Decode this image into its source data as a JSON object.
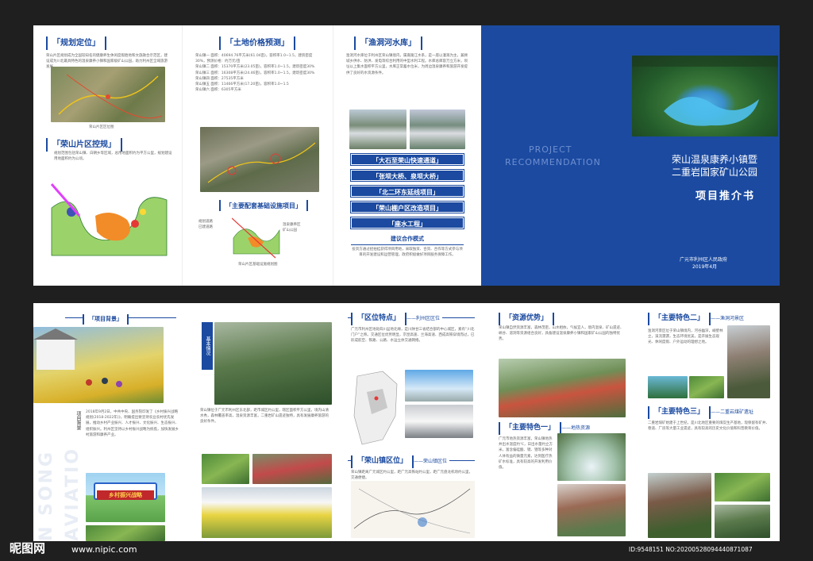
{
  "top": {
    "p1": {
      "title1": "「规划定位」",
      "text1": "荣山片区规划成为全国较知名的健康养生休闲度假胜地和文旅融合示范区，建设成为川北最具特色的温泉康养小镇和国家级矿山公园，助力利州区全域旅游发展。",
      "map_caption": "荣山片区区位图",
      "title2": "「荣山片区控规」",
      "text2": "规划范围包括荣山镇、白朝乡等区域，总用地面积约为平方公里，规划建设用地面积约为公顷。"
    },
    "p2": {
      "title1": "「土地价格预测」",
      "lines": [
        "荣山镇一 面积：40694.76平方米(61.04亩)，容积率1.0~1.5，建筑密度30%，预测价格：约万元/亩",
        "荣山镇二 面积：15370平方米(23.05亩)，容积率1.0~1.5，建筑密度30%",
        "荣山镇三 面积：16308平方米(24.46亩)，容积率1.0~1.5，建筑密度30%",
        "荣山镇四 面积：27535平方米",
        "荣山镇五 面积：11466平方米(17.20亩)，容积率1.0~1.5",
        "荣山镇六 面积：6305平方米"
      ],
      "title2": "「主要配套基础设施项目」",
      "legend": [
        "规划道路",
        "已建道路",
        "温泉康养区",
        "矿山公园"
      ],
      "plan_caption": "荣山片区基础设施规划图"
    },
    "p3": {
      "title": "「渔洞河水库」",
      "text": "渔洞河水库位于利州区荣山镇境内，属嘉陵江水系，是一座以灌溉为主，兼顾城乡供水、防洪、发电等综合利用的中型水利工程。水库总库容万立方米，坝址以上集水面积平方公里，水库正常蓄水位米，为周边温泉康养和旅游开发提供了良好的水资源条件。",
      "buttons": [
        "「大石至荣山快速通道」",
        "「张坝大桥、泉坝大桥」",
        "「北二环东延线项目」",
        "「荣山棚户区改造项目」",
        "「座水工程」"
      ],
      "coop_title": "建议合作模式",
      "coop_text": "投资方通过招拍挂获得项目用地，采取独资、合资、合作等方式参与项目的开发建设和运营管理，政府积极做好项目服务保障工作。"
    },
    "cover": {
      "en1": "PROJECT",
      "en2": "RECOMMENDATION",
      "title1": "荣山温泉康养小镇暨",
      "title2": "二重岩国家矿山公园",
      "subtitle": "项目推介书",
      "issuer": "广元市利州区人民政府",
      "date": "2019年4月"
    }
  },
  "bottom": {
    "p1": {
      "title": "「项目背景」",
      "vertical_label": "项目背景",
      "text": "2018年9月2日，中共中央、国务院印发了《乡村振兴战略规划(2018-2022年)》，明确提出要坚持农业农村优先发展，推动乡村产业振兴、人才振兴、文化振兴、生态振兴、组织振兴。利州区坚持以乡村振兴战略为统揽，加快发展乡村旅游和康养产业。",
      "banner": "乡村振兴战略",
      "watermark": "N SONG AVIATIO"
    },
    "p2": {
      "vertical_label": "基本情况",
      "text": "荣山镇位于广元市利州区东北部，距市城区约公里，辖区面积平方公里，境内山清水秀，森林覆盖率高，温泉资源丰富，二重岩矿山遗迹独特，具有发展康养旅游的良好条件。"
    },
    "p3": {
      "title1": "「区位特点」",
      "tail1": "——利州区区位",
      "text1": "广元市利州区地处四川盆地北缘，是川陕甘三省结合部的中心城区，素有“川北门户”之称。交通区位优势明显，京昆高速、兰海高速、西成高铁穿境而过，已形成航空、铁路、公路、水运立体交通网络。",
      "title2": "「荣山镇区位」",
      "tail2": "——荣山镇区位",
      "text2": "荣山镇距离广元城区约公里，距广元高铁站约公里，距广元盘龙机场约公里，交通便捷。"
    },
    "p4": {
      "title1": "「资源优势」",
      "text1": "荣山镇自然资源丰富，森林茂密，山水相依，气候宜人，境内温泉、矿山遗迹、峡谷、溶洞等资源组合良好，具备建设温泉康养小镇和国家矿山公园的独特优势。",
      "title2": "「主要特色一」",
      "tail2": "——地热资源",
      "text2": "广元市地热资源丰富，荣山镇地热井出水温度约℃，日出水量约立方米，富含偏硅酸、锶、锂等多种对人体有益的微量元素，达到医疗热矿水标准，具有较高的开发利用价值。"
    },
    "p5": {
      "title1": "「主要特色二」",
      "tail1": "——渔洞河景区",
      "text1": "渔洞河景区位于荣山镇境内，河谷幽深，峭壁林立，溪流潺潺，生态环境优美，是开展生态观光、休闲度假、户外运动的理想之地。",
      "title2": "「主要特色三」",
      "tail2": "——二重岩煤矿遗址",
      "text2": "二重岩煤矿始建于上世纪，是川北地区重要的煤炭生产基地，现保留有矿井、巷道、厂房等大量工业遗迹，具有较高的历史文化价值和科普教育价值。"
    }
  },
  "footer": {
    "logo": "昵图网",
    "url": "www.nipic.com",
    "id": "ID:9548151 NO:20200528094440871087"
  }
}
